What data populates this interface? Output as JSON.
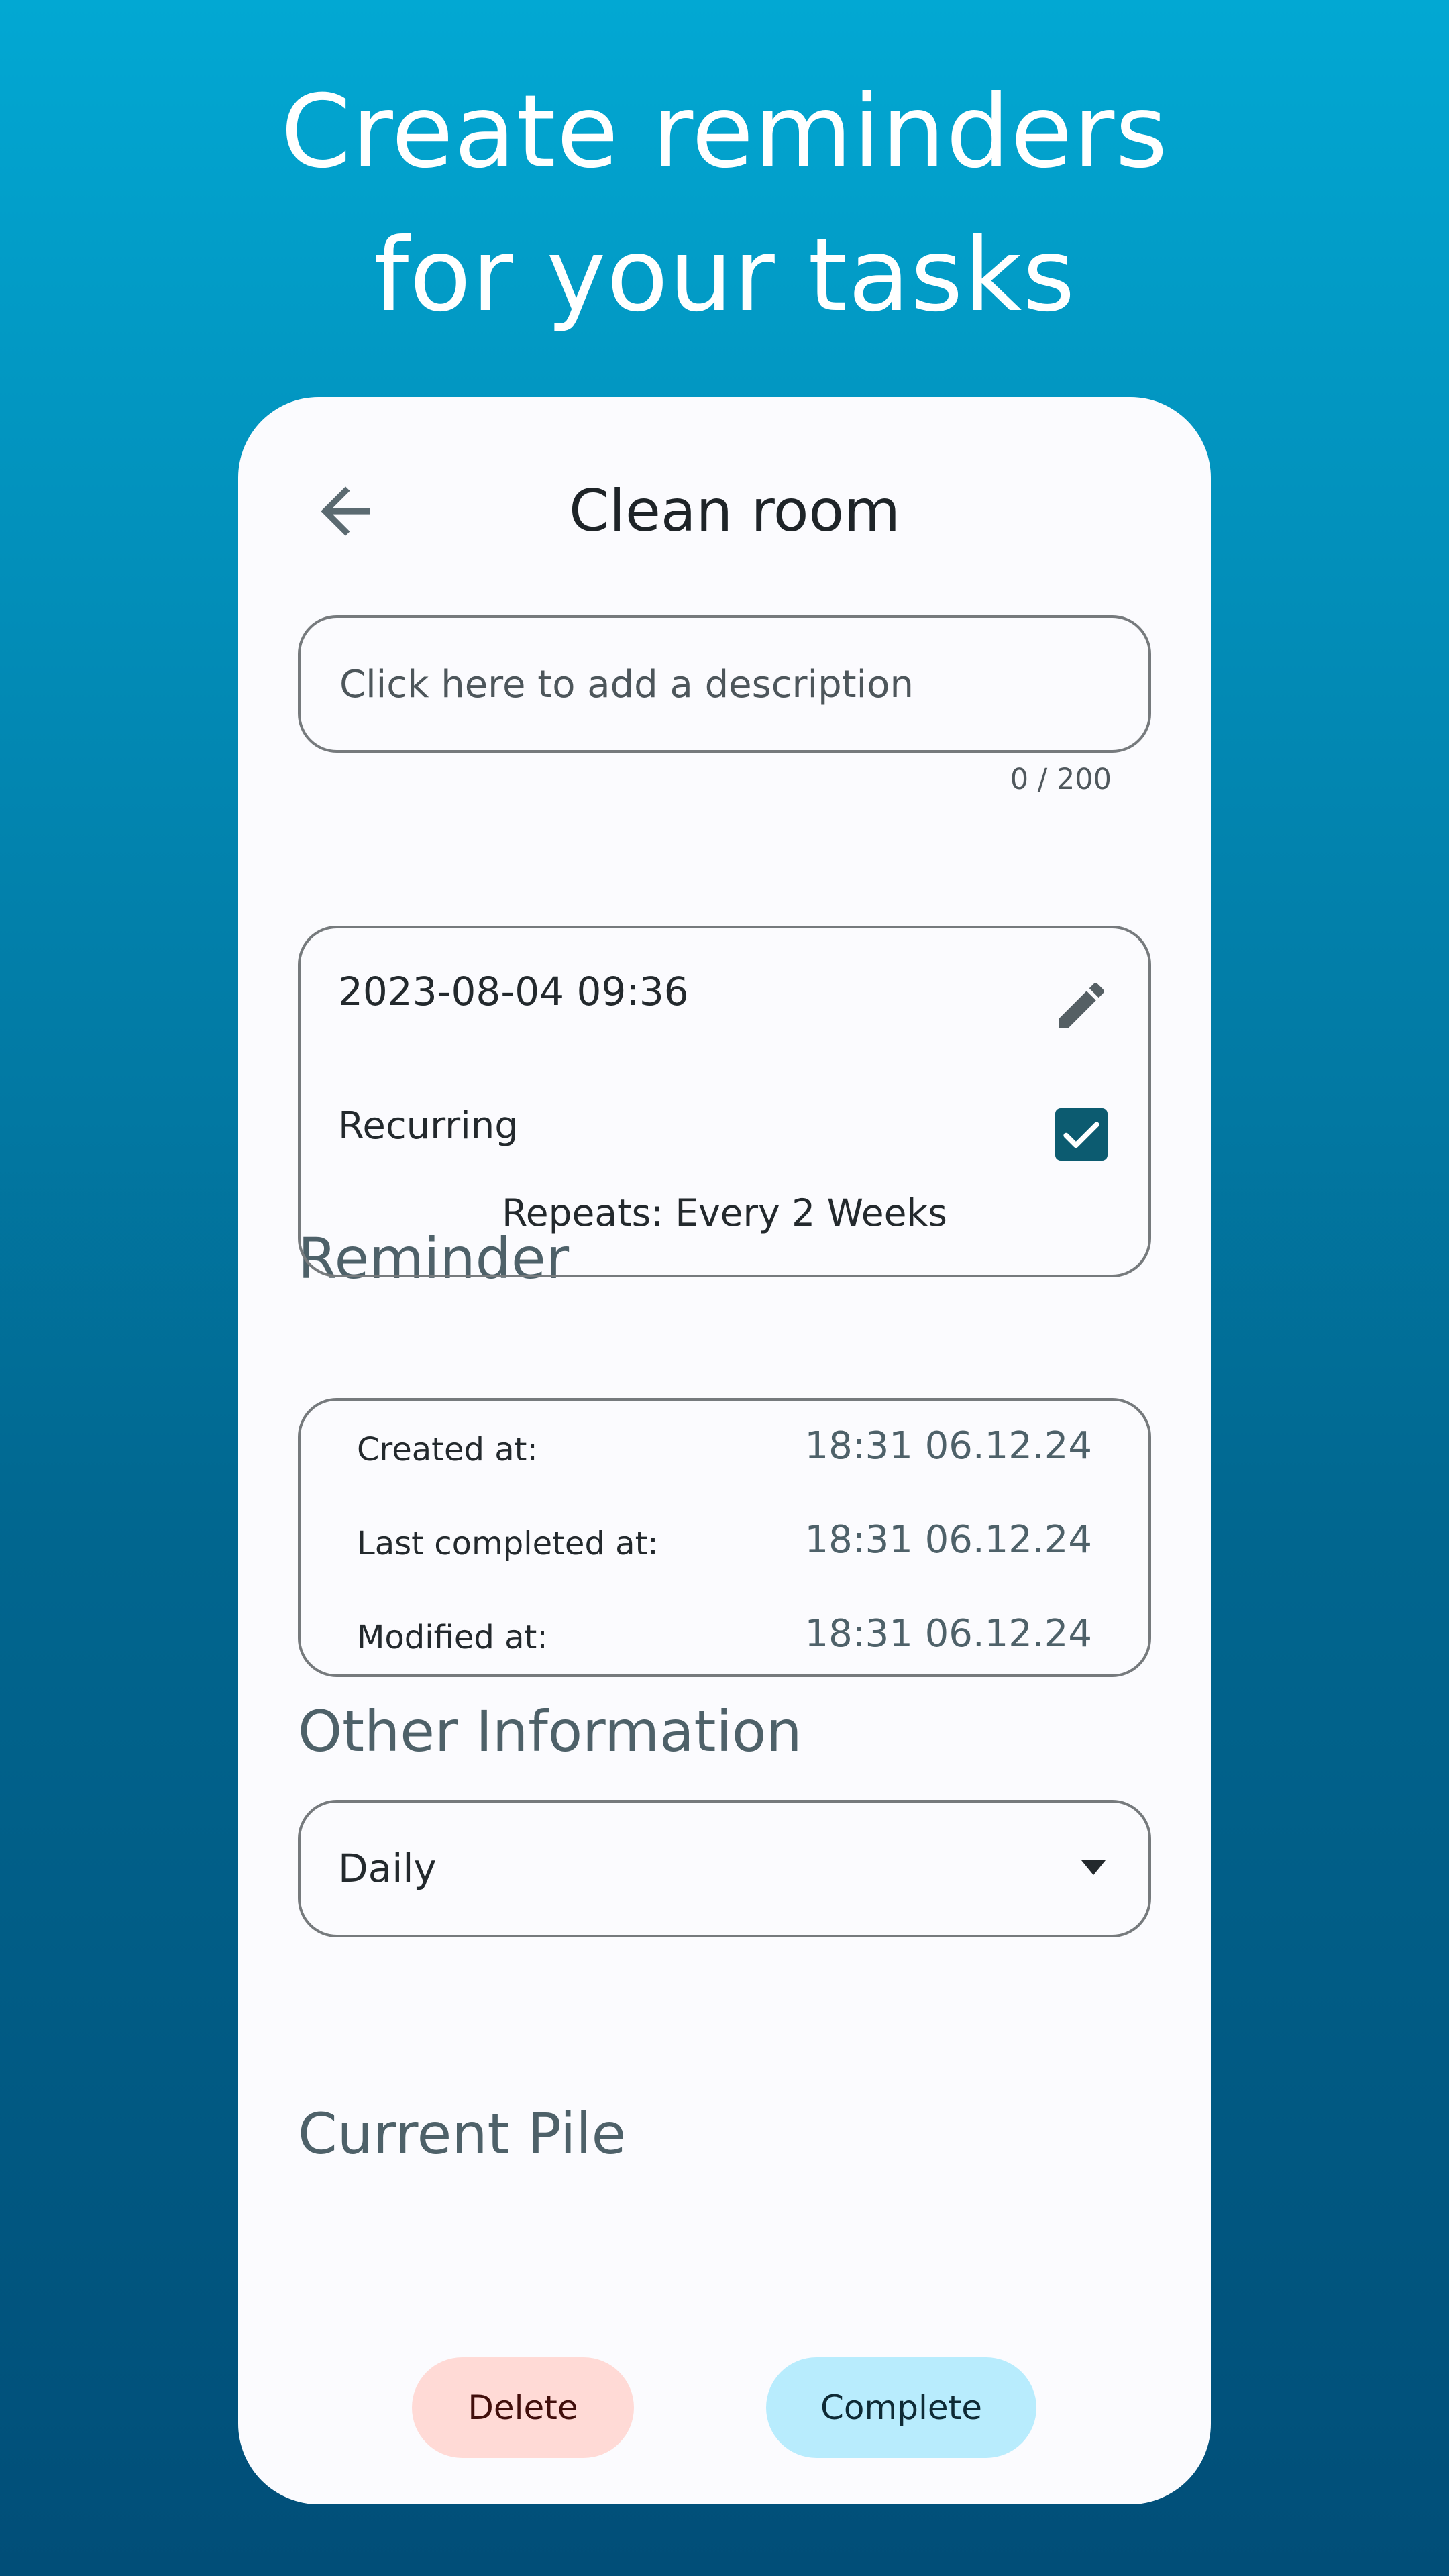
{
  "promo": {
    "headline_line1": "Create reminders",
    "headline_line2": "for your tasks"
  },
  "screen": {
    "title": "Clean room",
    "back_icon": "arrow-back-icon",
    "description": {
      "value": "",
      "placeholder": "Click here to add a description",
      "counter": "0 / 200"
    },
    "reminder": {
      "section_title": "Reminder",
      "datetime": "2023-08-04 09:36",
      "edit_icon": "pencil-icon",
      "recurring_label": "Recurring",
      "recurring_checked": true,
      "repeats_text": "Repeats: Every 2 Weeks"
    },
    "other_info": {
      "section_title": "Other Information",
      "rows": [
        {
          "label": "Created at:",
          "value": "18:31 06.12.24"
        },
        {
          "label": "Last completed at:",
          "value": "18:31 06.12.24"
        },
        {
          "label": "Modified at:",
          "value": "18:31 06.12.24"
        }
      ]
    },
    "current_pile": {
      "section_title": "Current Pile",
      "selected": "Daily",
      "caret_icon": "dropdown-caret-icon"
    },
    "actions": {
      "delete_label": "Delete",
      "complete_label": "Complete"
    }
  },
  "colors": {
    "gradient_top": "#02a8d3",
    "gradient_bottom": "#014e78",
    "card_bg": "#fbfbfe",
    "delete_bg": "#ffdad6",
    "complete_bg": "#b8ecfd",
    "checkbox": "#0c5b70",
    "section_title": "#4e6169"
  }
}
